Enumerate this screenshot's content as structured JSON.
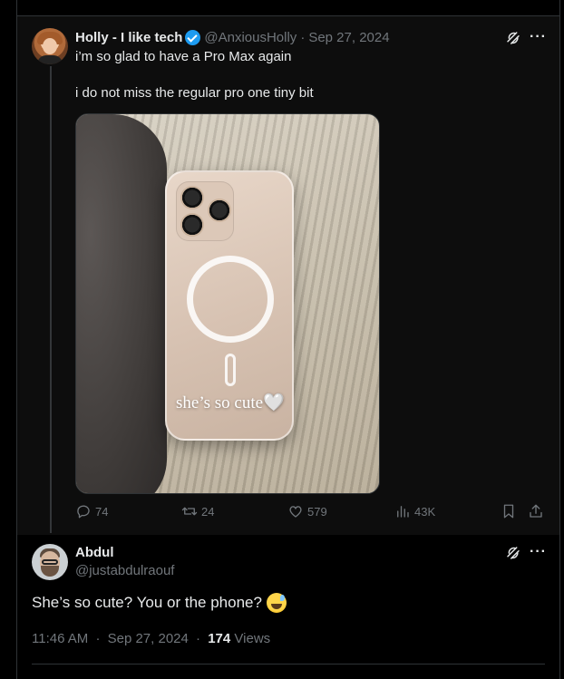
{
  "tweet": {
    "author_name": "Holly - I like tech",
    "author_handle": "@AnxiousHolly",
    "separator": "·",
    "date": "Sep 27, 2024",
    "text_line1": "i’m so glad to have a Pro Max again",
    "text_line2": "i do not miss the regular pro  one tiny bit",
    "media_caption": "she’s so cute🤍",
    "stats": {
      "replies": "74",
      "reposts": "24",
      "likes": "579",
      "views": "43K"
    }
  },
  "reply": {
    "author_name": "Abdul",
    "author_handle": "@justabdulraouf",
    "text": "She’s so cute? You or the phone?",
    "time": "11:46 AM",
    "separator": "·",
    "date": "Sep 27, 2024",
    "views_count": "174",
    "views_label": "Views"
  },
  "icons": {
    "verified": "verified-badge-icon",
    "grok": "grok-icon",
    "more": "more-icon",
    "reply": "reply-icon",
    "repost": "repost-icon",
    "like": "like-icon",
    "views": "views-icon",
    "bookmark": "bookmark-icon",
    "share": "share-icon"
  },
  "colors": {
    "background": "#000000",
    "text": "#e7e9ea",
    "muted": "#71767b",
    "verified": "#1d9bf0",
    "border": "#2f3336"
  }
}
